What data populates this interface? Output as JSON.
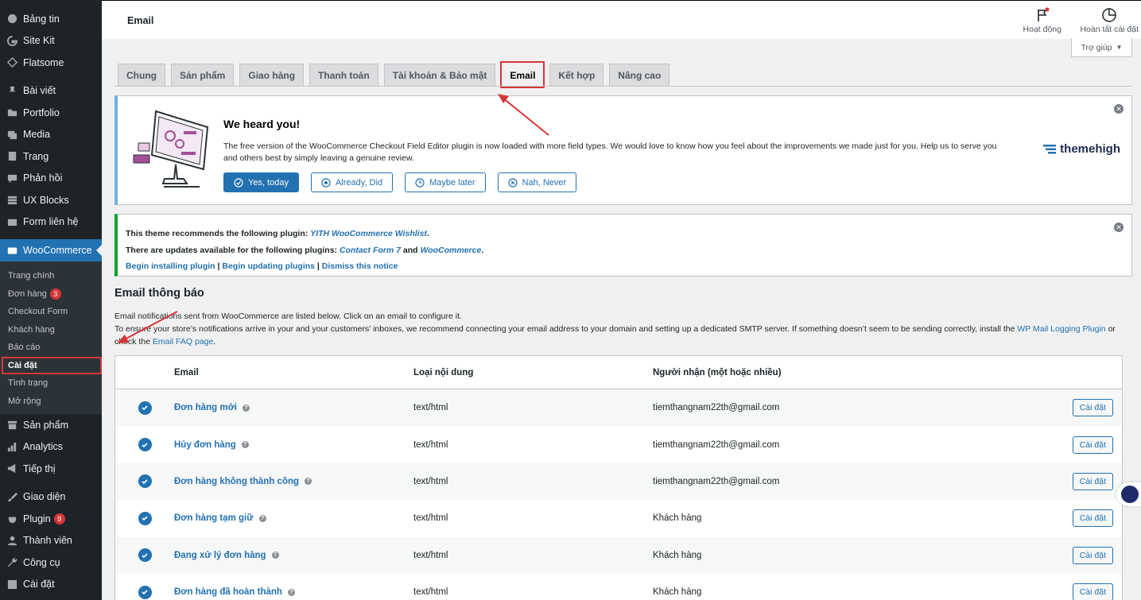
{
  "sidebar": {
    "top_items": [
      {
        "label": "Bảng tin",
        "icon": "dashboard-icon"
      },
      {
        "label": "Site Kit",
        "icon": "google-g-icon"
      },
      {
        "label": "Flatsome",
        "icon": "flatsome-icon"
      }
    ],
    "content_items": [
      {
        "label": "Bài viết",
        "icon": "pin-icon"
      },
      {
        "label": "Portfolio",
        "icon": "folder-icon"
      },
      {
        "label": "Media",
        "icon": "media-icon"
      },
      {
        "label": "Trang",
        "icon": "page-icon"
      },
      {
        "label": "Phản hồi",
        "icon": "comment-icon"
      },
      {
        "label": "UX Blocks",
        "icon": "blocks-icon"
      },
      {
        "label": "Form liên hệ",
        "icon": "mail-icon"
      }
    ],
    "woocommerce": {
      "label": "WooCommerce",
      "icon": "woo-icon"
    },
    "woo_submenu": [
      {
        "label": "Trang chính",
        "badge": ""
      },
      {
        "label": "Đơn hàng",
        "badge": "3"
      },
      {
        "label": "Checkout Form",
        "badge": ""
      },
      {
        "label": "Khách hàng",
        "badge": ""
      },
      {
        "label": "Báo cáo",
        "badge": ""
      },
      {
        "label": "Cài đặt",
        "badge": "",
        "active": true
      },
      {
        "label": "Tình trạng",
        "badge": ""
      },
      {
        "label": "Mở rộng",
        "badge": ""
      }
    ],
    "lower_items": [
      {
        "label": "Sản phẩm",
        "icon": "archive-icon",
        "badge": ""
      },
      {
        "label": "Analytics",
        "icon": "bar-chart-icon",
        "badge": ""
      },
      {
        "label": "Tiếp thị",
        "icon": "megaphone-icon",
        "badge": ""
      }
    ],
    "admin_items": [
      {
        "label": "Giao diện",
        "icon": "brush-icon",
        "badge": ""
      },
      {
        "label": "Plugin",
        "icon": "plugin-icon",
        "badge": "9"
      },
      {
        "label": "Thành viên",
        "icon": "user-icon",
        "badge": ""
      },
      {
        "label": "Công cụ",
        "icon": "wrench-icon",
        "badge": ""
      },
      {
        "label": "Cài đặt",
        "icon": "settings-icon",
        "badge": ""
      }
    ]
  },
  "topbar": {
    "title": "Email",
    "activity_label": "Hoạt động",
    "finish_setup_label": "Hoàn tất cài đặt",
    "help_label": "Trợ giúp"
  },
  "tabs": [
    {
      "label": "Chung",
      "active": false
    },
    {
      "label": "Sản phẩm",
      "active": false
    },
    {
      "label": "Giao hàng",
      "active": false
    },
    {
      "label": "Thanh toán",
      "active": false
    },
    {
      "label": "Tài khoản & Bảo mật",
      "active": false
    },
    {
      "label": "Email",
      "active": true
    },
    {
      "label": "Kết hợp",
      "active": false
    },
    {
      "label": "Nâng cao",
      "active": false
    }
  ],
  "notice_feedback": {
    "title": "We heard you!",
    "text": "The free version of the WooCommerce Checkout Field Editor plugin is now loaded with more field types. We would love to know how you feel about the improvements we made just for you. Help us to serve you and others best by simply leaving a genuine review.",
    "buttons": [
      "Yes, today",
      "Already, Did",
      "Maybe later",
      "Nah, Never"
    ],
    "brand": "themehigh"
  },
  "notice_plugins": {
    "line1_prefix": "This theme recommends the following plugin: ",
    "line1_link": "YITH WooCommerce Wishlist",
    "line1_suffix": ".",
    "line2_prefix": "There are updates available for the following plugins: ",
    "line2_link1": "Contact Form 7",
    "line2_and": " and ",
    "line2_link2": "WooCommerce",
    "line2_suffix": ".",
    "action_install": "Begin installing plugin",
    "action_update": "Begin updating plugins",
    "action_dismiss": "Dismiss this notice",
    "separator": " | "
  },
  "section": {
    "title": "Email thông báo",
    "desc_line1": "Email notifications sent from WooCommerce are listed below. Click on an email to configure it.",
    "desc_line2_prefix": "To ensure your store’s notifications arrive in your and your customers’ inboxes, we recommend connecting your email address to your domain and setting up a dedicated SMTP server. If something doesn’t seem to be sending correctly, install the ",
    "desc_link1": "WP Mail Logging Plugin",
    "desc_mid": " or check the ",
    "desc_link2": "Email FAQ page",
    "desc_end": "."
  },
  "email_table": {
    "headers": [
      "Email",
      "Loại nội dung",
      "Người nhận (một hoặc nhiều)"
    ],
    "button_label": "Cài đặt",
    "rows": [
      {
        "name": "Đơn hàng mới",
        "type": "text/html",
        "recipient": "tiemthangnam22th@gmail.com"
      },
      {
        "name": "Hủy đơn hàng",
        "type": "text/html",
        "recipient": "tiemthangnam22th@gmail.com"
      },
      {
        "name": "Đơn hàng không thành công",
        "type": "text/html",
        "recipient": "tiemthangnam22th@gmail.com"
      },
      {
        "name": "Đơn hàng tạm giữ",
        "type": "text/html",
        "recipient": "Khách hàng"
      },
      {
        "name": "Đang xử lý đơn hàng",
        "type": "text/html",
        "recipient": "Khách hàng"
      },
      {
        "name": "Đơn hàng đã hoàn thành",
        "type": "text/html",
        "recipient": "Khách hàng"
      }
    ]
  },
  "colors": {
    "accent": "#2271b1",
    "annotation_red": "#d63638",
    "sidebar_bg": "#1d2327"
  }
}
